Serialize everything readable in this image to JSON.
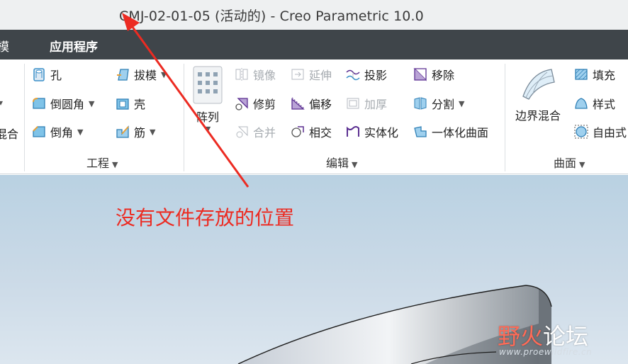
{
  "window": {
    "title": "CMJ-02-01-05 (活动的) - Creo Parametric 10.0"
  },
  "menubar": {
    "items": [
      "模",
      "应用程序"
    ]
  },
  "left_fragments": {
    "row2_label": "混合"
  },
  "groups": {
    "engineering": {
      "label": "工程",
      "tools": {
        "hole": "孔",
        "draft": "拔模",
        "round": "倒圆角",
        "shell": "壳",
        "chamfer": "倒角",
        "rib": "筋"
      }
    },
    "editing": {
      "label": "编辑",
      "pattern": "阵列",
      "tools": {
        "mirror": "镜像",
        "extend": "延伸",
        "project": "投影",
        "remove": "移除",
        "trim": "修剪",
        "offset": "偏移",
        "thicken": "加厚",
        "split": "分割",
        "merge": "合并",
        "intersect": "相交",
        "solidify": "实体化",
        "unify_surface": "一体化曲面"
      }
    },
    "surfaces": {
      "label": "曲面",
      "boundary_blend": "边界混合",
      "tools": {
        "fill": "填充",
        "style": "样式",
        "freestyle": "自由式"
      }
    }
  },
  "annotation": {
    "text": "没有文件存放的位置",
    "color": "#ec2b22"
  },
  "watermark": {
    "part1": "野火",
    "part2": "论坛",
    "url": "www.proewildfire.cn"
  },
  "colors": {
    "menubar": "#3f454a",
    "accent_purple": "#5b2f91",
    "icon_blue": "#3a8fc8"
  }
}
